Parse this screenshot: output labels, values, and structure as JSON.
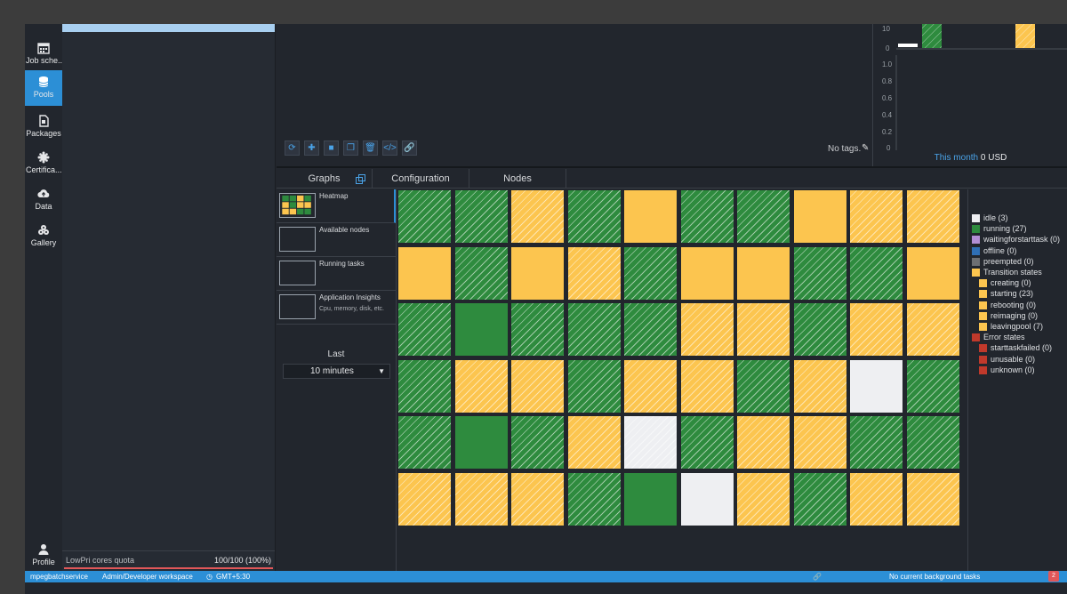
{
  "nav": {
    "items": [
      {
        "label": "Job sche...",
        "icon": "calendar-icon"
      },
      {
        "label": "Pools",
        "icon": "database-icon",
        "active": true
      },
      {
        "label": "Packages",
        "icon": "package-icon"
      },
      {
        "label": "Certifica...",
        "icon": "certificate-icon"
      },
      {
        "label": "Data",
        "icon": "cloud-upload-icon"
      },
      {
        "label": "Gallery",
        "icon": "gallery-icon"
      }
    ],
    "profile_label": "Profile"
  },
  "quota": {
    "label": "LowPri cores quota",
    "value": "100/100 (100%)",
    "fraction": 1.0
  },
  "toolbar": {
    "buttons": [
      "refresh-icon",
      "add-icon",
      "stop-icon",
      "copy-icon",
      "delete-icon",
      "code-icon",
      "link-icon"
    ]
  },
  "tags": {
    "text": "No tags."
  },
  "cost": {
    "top_ticks": [
      "10",
      "0"
    ],
    "y_ticks": [
      "1.0",
      "0.8",
      "0.6",
      "0.4",
      "0.2",
      "0"
    ],
    "link": "This month",
    "amount": "0 USD"
  },
  "tabs": {
    "graphs": "Graphs",
    "configuration": "Configuration",
    "nodes": "Nodes"
  },
  "graphs": [
    {
      "name": "Heatmap",
      "sub": ""
    },
    {
      "name": "Available nodes",
      "sub": ""
    },
    {
      "name": "Running tasks",
      "sub": ""
    },
    {
      "name": "Application Insights",
      "sub": "Cpu, memory, disk, etc."
    }
  ],
  "last": {
    "label": "Last",
    "value": "10 minutes"
  },
  "heatmap": {
    "cols": 10,
    "rows": 6,
    "cells": [
      "running-h",
      "running-h",
      "trans-h",
      "running-h",
      "trans",
      "running-h",
      "running-h",
      "trans",
      "trans-h",
      "trans-h",
      "trans",
      "running-h",
      "trans",
      "trans-h",
      "running-h",
      "trans",
      "trans",
      "running-h",
      "running-h",
      "trans",
      "running-h",
      "running",
      "running-h",
      "running-h",
      "running-h",
      "trans-h",
      "trans-h",
      "running-h",
      "trans-h",
      "trans-h",
      "running-h",
      "trans-h",
      "trans-h",
      "running-h",
      "trans-h",
      "trans-h",
      "running-h",
      "trans-h",
      "idle",
      "running-h",
      "running-h",
      "running",
      "running-h",
      "trans-h",
      "idle-h",
      "running-h",
      "trans-h",
      "trans-h",
      "running-h",
      "running-h",
      "trans-h",
      "trans-h",
      "trans-h",
      "running-h",
      "running",
      "idle",
      "trans-h",
      "running-h",
      "trans-h",
      "trans-h"
    ]
  },
  "legend": [
    {
      "label": "idle (3)",
      "color": "#eeeff2",
      "indent": 0
    },
    {
      "label": "running (27)",
      "color": "#2e8b3e",
      "indent": 0
    },
    {
      "label": "waitingforstarttask (0)",
      "color": "#b28fd4",
      "indent": 0
    },
    {
      "label": "offline (0)",
      "color": "#2f6fb5",
      "indent": 0
    },
    {
      "label": "preempted (0)",
      "color": "#6d6f72",
      "indent": 0
    },
    {
      "label": "Transition states",
      "color": "#fcc54f",
      "indent": 0
    },
    {
      "label": "creating (0)",
      "color": "#fcc54f",
      "indent": 1
    },
    {
      "label": "starting (23)",
      "color": "#fcc54f",
      "indent": 1
    },
    {
      "label": "rebooting (0)",
      "color": "#fcc54f",
      "indent": 1
    },
    {
      "label": "reimaging (0)",
      "color": "#fcc54f",
      "indent": 1
    },
    {
      "label": "leavingpool (7)",
      "color": "#fcc54f",
      "indent": 1
    },
    {
      "label": "Error states",
      "color": "#c0392b",
      "indent": 0
    },
    {
      "label": "starttaskfailed (0)",
      "color": "#c0392b",
      "indent": 1
    },
    {
      "label": "unusable (0)",
      "color": "#c0392b",
      "indent": 1
    },
    {
      "label": "unknown (0)",
      "color": "#c0392b",
      "indent": 1
    }
  ],
  "status": {
    "account": "mpegbatchservice",
    "workspace": "Admin/Developer workspace",
    "timezone": "GMT+5:30",
    "tasks": "No current background tasks",
    "badge": "2"
  }
}
